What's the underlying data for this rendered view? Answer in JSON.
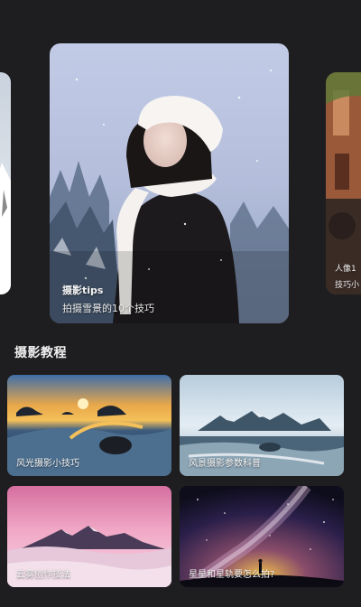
{
  "carousel": {
    "main": {
      "title": "摄影tips",
      "subtitle": "拍摄雪景的10个技巧"
    },
    "right": {
      "title": "人像1",
      "subtitle": "技巧小"
    }
  },
  "section": {
    "title": "摄影教程"
  },
  "tutorials": [
    {
      "label": "风光摄影小技巧"
    },
    {
      "label": "风景摄影参数科普"
    },
    {
      "label": "云雾创作技法"
    },
    {
      "label": "星星和星轨要怎么拍?"
    }
  ],
  "colors": {
    "background": "#1e1e21",
    "text": "#f2f2f2"
  }
}
